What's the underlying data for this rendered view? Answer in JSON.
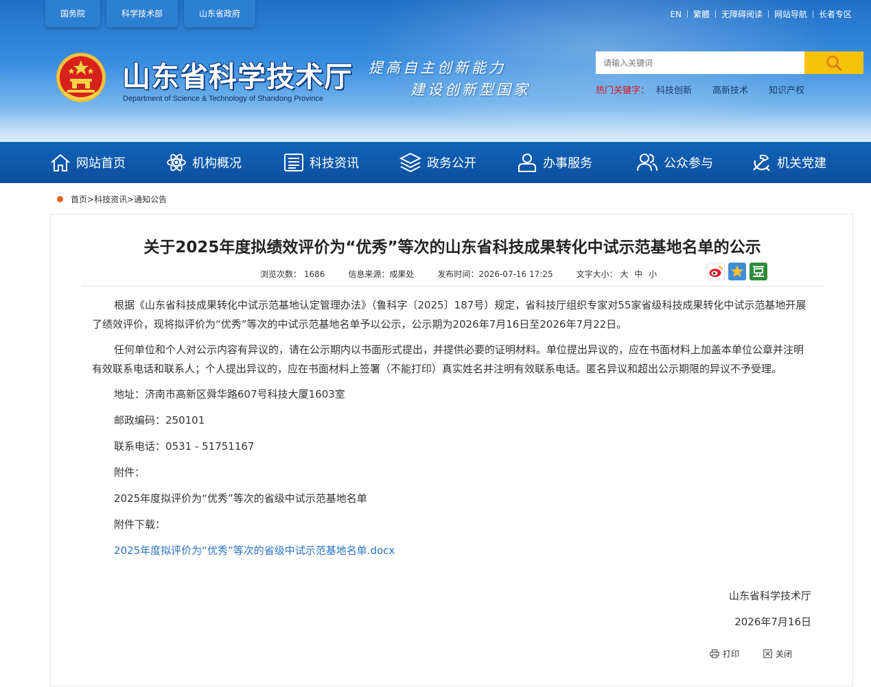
{
  "top_tabs": [
    "国务院",
    "科学技术部",
    "山东省政府"
  ],
  "top_links": [
    "EN",
    "繁體",
    "无障碍阅读",
    "网站导航",
    "长者专区"
  ],
  "site": {
    "title": "山东省科学技术厅",
    "subtitle": "Department of Science & Technology of Shandong Province",
    "slogan_line1": "提高自主创新能力",
    "slogan_line2": "建设创新型国家"
  },
  "search": {
    "placeholder": "请输入关键词",
    "hot_label": "热门关键字：",
    "hot_items": [
      "科技创新",
      "高新技术",
      "知识产权"
    ]
  },
  "nav": [
    "网站首页",
    "机构概况",
    "科技资讯",
    "政务公开",
    "办事服务",
    "公众参与",
    "机关党建"
  ],
  "breadcrumb": [
    "首页",
    "科技资讯",
    "通知公告"
  ],
  "breadcrumb_sep": ">",
  "article": {
    "title": "关于2025年度拟绩效评价为“优秀”等次的山东省科技成果转化中试示范基地名单的公示",
    "meta": {
      "views_label": "浏览次数：",
      "views": "1686",
      "source_label": "信息来源：",
      "source": "成果处",
      "date_label": "发布时间：",
      "date": "2026-07-16 17:25",
      "fontsize_label": "文字大小：",
      "fontsize_options": [
        "大",
        "中",
        "小"
      ]
    },
    "paragraphs": [
      "根据《山东省科技成果转化中试示范基地认定管理办法》（鲁科字〔2025〕187号）规定，省科技厅组织专家对55家省级科技成果转化中试示范基地开展了绩效评价，现将拟评价为“优秀”等次的中试示范基地名单予以公示，公示期为2026年7月16日至2026年7月22日。",
      "任何单位和个人对公示内容有异议的，请在公示期内以书面形式提出，并提供必要的证明材料。单位提出异议的，应在书面材料上加盖本单位公章并注明有效联系电话和联系人；个人提出异议的，应在书面材料上签署（不能打印）真实姓名并注明有效联系电话。匿名异议和超出公示期限的异议不予受理。"
    ],
    "address": "地址：济南市高新区舜华路607号科技大厦1603室",
    "postcode": "邮政编码：250101",
    "phone": "联系电话：0531 - 51751167",
    "attachment_label": "附件：",
    "attachment_name": "2025年度拟评价为“优秀”等次的省级中试示范基地名单",
    "download_label": "附件下载：",
    "download_link": "2025年度拟评价为“优秀”等次的省级中试示范基地名单.docx",
    "signature_org": "山东省科学技术厅",
    "signature_date": "2026年7月16日"
  },
  "tools": {
    "print": "打印",
    "close": "关闭"
  },
  "colors": {
    "header_blue": "#1f6fc6",
    "nav_blue": "#0b4f9d",
    "search_button": "#f7c20a",
    "hot_red": "#d8141a",
    "link_blue": "#2a74c0"
  }
}
